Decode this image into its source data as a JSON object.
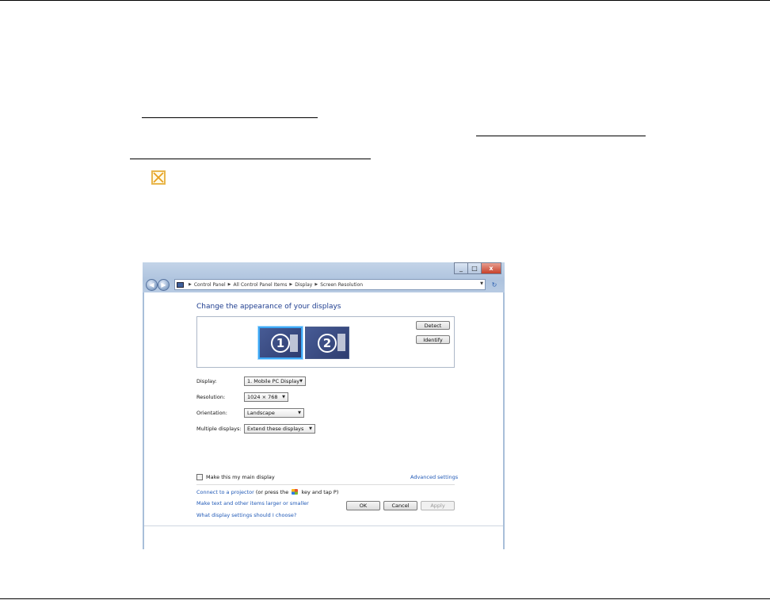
{
  "window": {
    "caption": {
      "minimize": "_",
      "maximize": "□",
      "close": "x"
    },
    "breadcrumb": [
      "Control Panel",
      "All Control Panel Items",
      "Display",
      "Screen Resolution"
    ],
    "heading": "Change the appearance of your displays",
    "monitors": [
      "1",
      "2"
    ],
    "buttons": {
      "detect": "Detect",
      "identify": "Identify",
      "ok": "OK",
      "cancel": "Cancel",
      "apply": "Apply"
    },
    "settings": {
      "display_label": "Display:",
      "display_value": "1. Mobile PC Display",
      "resolution_label": "Resolution:",
      "resolution_value": "1024 × 768",
      "orientation_label": "Orientation:",
      "orientation_value": "Landscape",
      "multiple_label": "Multiple displays:",
      "multiple_value": "Extend these displays"
    },
    "main_display_label": "Make this my main display",
    "advanced_settings": "Advanced settings",
    "links": {
      "projector_link": "Connect to a projector",
      "projector_pre": "(or press the",
      "projector_post": "key and tap P)",
      "text_size": "Make text and other items larger or smaller",
      "which_settings": "What display settings should I choose?"
    }
  },
  "icons": {
    "broken_image": "broken-image-icon",
    "windows_key": "windows-key-icon"
  }
}
